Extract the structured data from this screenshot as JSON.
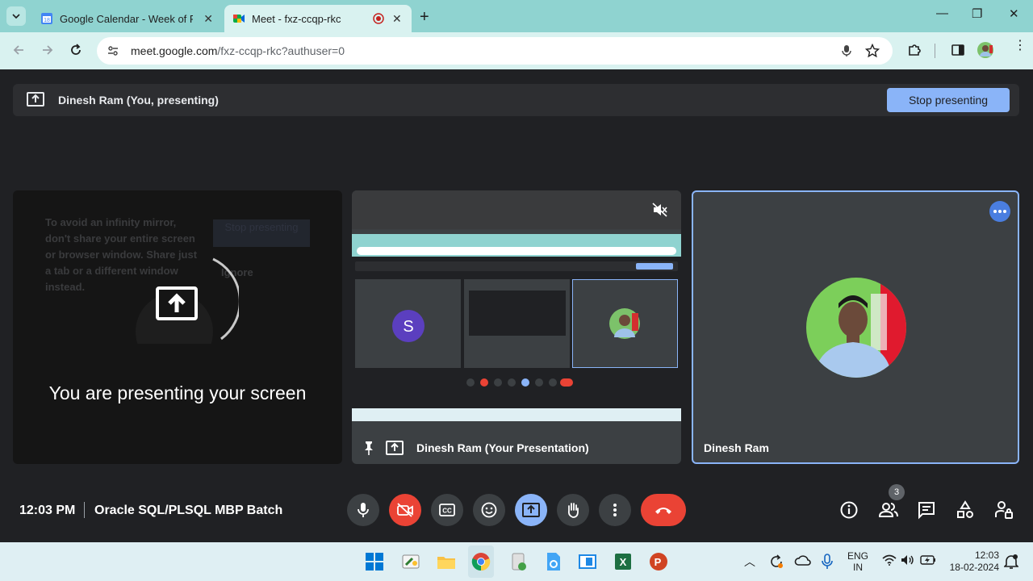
{
  "browser": {
    "tabs": [
      {
        "title": "Google Calendar - Week of Feb",
        "icon": "calendar-favicon"
      },
      {
        "title": "Meet - fxz-ccqp-rkc",
        "icon": "meet-favicon",
        "recording": true
      }
    ],
    "url_host": "meet.google.com",
    "url_path": "/fxz-ccqp-rkc?authuser=0"
  },
  "banner": {
    "text": "Dinesh Ram (You, presenting)",
    "stop_label": "Stop presenting"
  },
  "tiles": {
    "self": {
      "faint_warning": "To avoid an infinity mirror, don't share your entire screen or browser window. Share just a tab or a different window instead.",
      "faint_stop": "Stop presenting",
      "faint_ignore": "Ignore",
      "message": "You are presenting your screen"
    },
    "presentation": {
      "label": "Dinesh Ram (Your Presentation)",
      "thumb_avatar_letter": "S"
    },
    "participant": {
      "label": "Dinesh Ram"
    }
  },
  "bottom_bar": {
    "time": "12:03 PM",
    "meeting_name": "Oracle SQL/PLSQL MBP Batch",
    "people_count": "3"
  },
  "taskbar": {
    "lang_line1": "ENG",
    "lang_line2": "IN",
    "time": "12:03",
    "date": "18-02-2024"
  },
  "colors": {
    "accent": "#8ab4f8",
    "danger": "#ea4335",
    "tile_bg": "#3c4043",
    "page_bg": "#202124"
  }
}
